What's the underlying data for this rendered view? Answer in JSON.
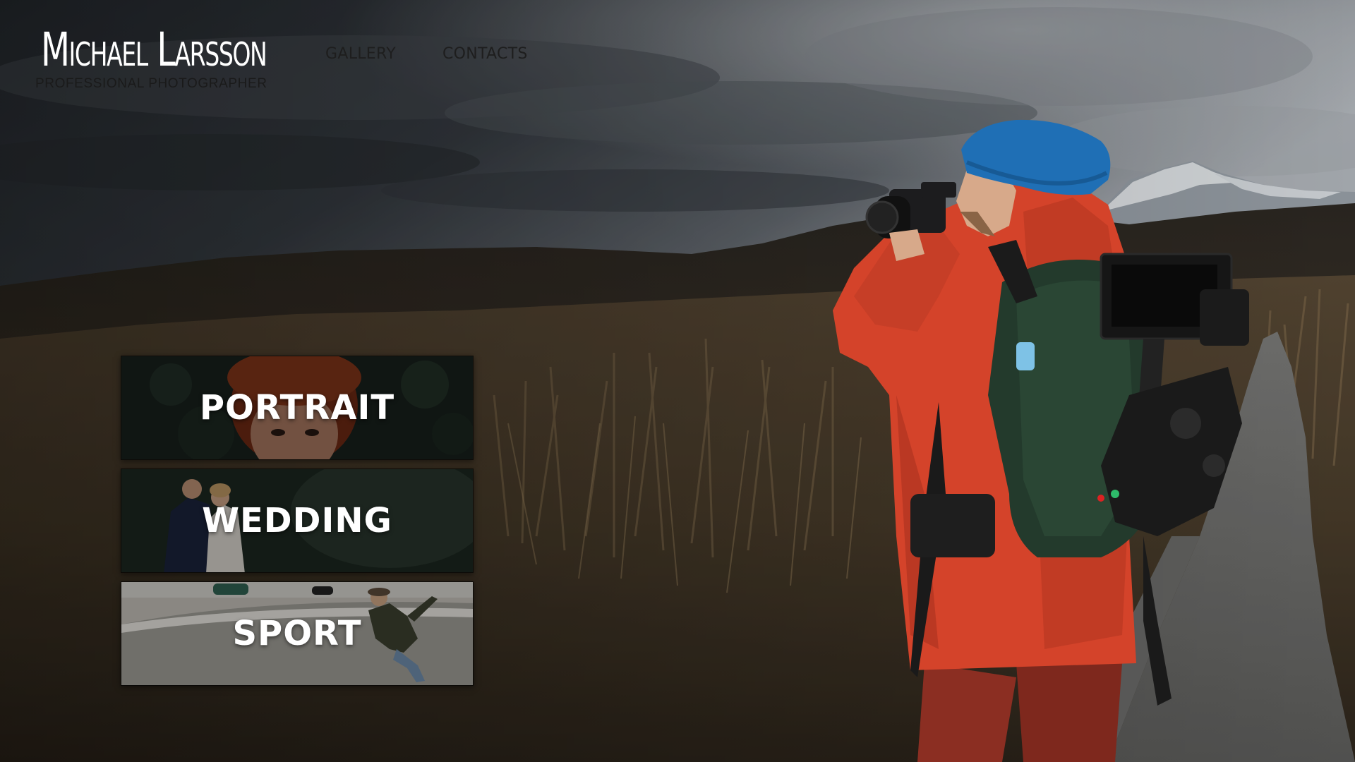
{
  "brand": {
    "name": "Michael Larsson",
    "tagline": "PROFESSIONAL PHOTOGRAPHER"
  },
  "nav": {
    "items": [
      {
        "label": "GALLERY"
      },
      {
        "label": "CONTACTS"
      }
    ]
  },
  "categories": [
    {
      "label": "PORTRAIT"
    },
    {
      "label": "WEDDING"
    },
    {
      "label": "SPORT"
    }
  ],
  "colors": {
    "jacket": "#d4432a",
    "beanie": "#1f6fb5",
    "sky": "#4a4f55"
  },
  "icons": {
    "photographer": "photographer-illustration",
    "mountain": "mountain-illustration"
  }
}
